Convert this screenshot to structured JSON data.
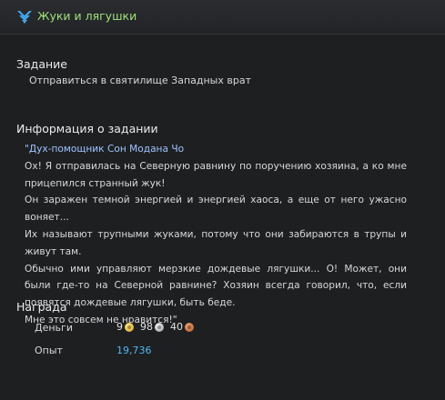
{
  "header": {
    "icon": "chevron-down-icon",
    "title": "Жуки и лягушки"
  },
  "task": {
    "heading": "Задание",
    "objective": "Отправиться в святилище Западных врат"
  },
  "info": {
    "heading": "Информация о задании",
    "speaker": "\"Дух-помощник Сон Модана Чо",
    "paragraphs": [
      "Ох! Я отправилась на Северную равнину по поручению хозяина, а ко мне прицепился странный жук!",
      "Он заражен темной энергией и энергией хаоса, а еще от него ужасно воняет...",
      "Их называют трупными жуками, потому что они забираются в трупы и живут там.",
      "Обычно ими управляют мерзкие дождевые лягушки... О! Может, они были где-то на Северной равнине? Хозяин всегда говорил, что, если появятся дождевые лягушки, быть беде.",
      "Мне это совсем не нравится!\""
    ]
  },
  "reward": {
    "heading": "Награда",
    "money_label": "Деньги",
    "gold": "9",
    "silver": "98",
    "copper": "40",
    "exp_label": "Опыт",
    "exp_value": "19,736",
    "colors": {
      "gold": "#e8c040",
      "silver": "#c8c8c8",
      "copper": "#d07a44",
      "exp": "#4fb8ee"
    }
  }
}
